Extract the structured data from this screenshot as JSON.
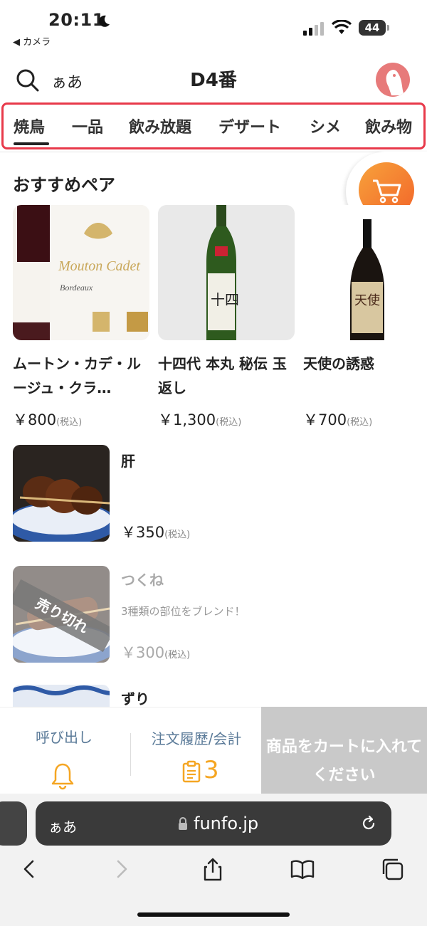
{
  "status": {
    "time": "20:11",
    "back_app": "◀ カメラ",
    "battery": "44"
  },
  "header": {
    "lang": "ぁあ",
    "title": "D4番"
  },
  "tabs": [
    "焼鳥",
    "一品",
    "飲み放題",
    "デザート",
    "シメ",
    "飲み物"
  ],
  "section_title": "おすすめペア",
  "recommend": [
    {
      "name": "ムートン・カデ・ルージュ・クラ…",
      "price": "￥800",
      "tax": "(税込)"
    },
    {
      "name": "十四代 本丸 秘伝 玉返し",
      "price": "￥1,300",
      "tax": "(税込)"
    },
    {
      "name": "天使の誘惑",
      "price": "￥700",
      "tax": "(税込)"
    }
  ],
  "items": [
    {
      "name": "肝",
      "desc": "",
      "price": "￥350",
      "tax": "(税込)"
    },
    {
      "name": "つくね",
      "desc": "3種類の部位をブレンド！",
      "price": "￥300",
      "tax": "(税込)",
      "badge": "売り切れ"
    },
    {
      "name": "ずり"
    }
  ],
  "actions": {
    "call": "呼び出し",
    "history": "注文履歴/会計",
    "history_count": "3",
    "add_cart": "商品をカートに入れてください"
  },
  "browser": {
    "aa": "ぁあ",
    "url": "funfo.jp"
  },
  "colors": {
    "accent": "#f5a623",
    "tab_highlight": "#e8394a",
    "cart_gradient_start": "#f7a23b",
    "cart_gradient_end": "#f2652a",
    "disabled": "#c9c9c9"
  }
}
